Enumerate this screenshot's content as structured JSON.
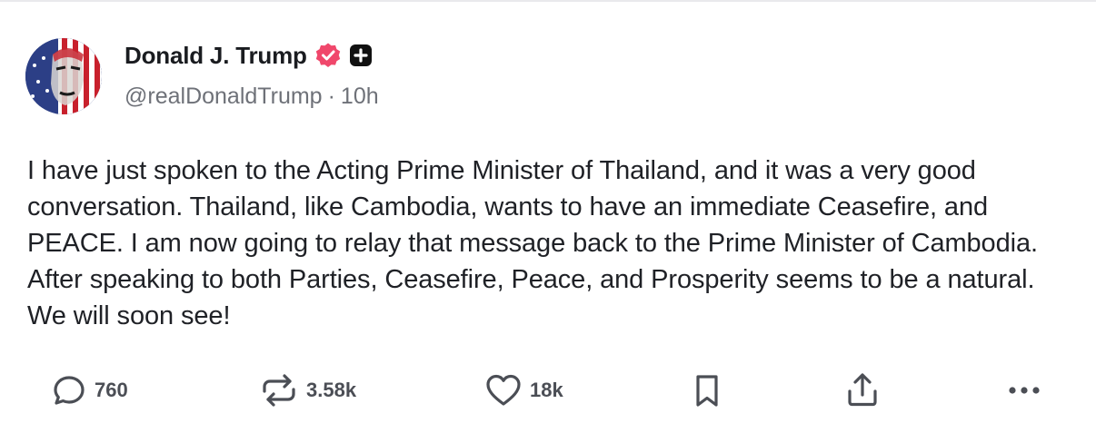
{
  "author": {
    "display_name": "Donald J. Trump",
    "handle": "@realDonaldTrump",
    "separator": "·",
    "time_ago": "10h",
    "verified_badge": "verified-check-icon",
    "badge_color": "#f0476b",
    "plus_badge": "plus-square-icon"
  },
  "post": {
    "text": "I have just spoken to the Acting Prime Minister of Thailand, and it was a very good conversation. Thailand, like Cambodia, wants to have an immediate Ceasefire, and PEACE. I am now going to relay that message back to the Prime Minister of Cambodia. After speaking to both Parties, Ceasefire, Peace, and Prosperity seems to be a natural. We will soon see!"
  },
  "actions": {
    "replies": {
      "icon": "reply-bubble-icon",
      "count": "760"
    },
    "retruths": {
      "icon": "repost-icon",
      "count": "3.58k"
    },
    "likes": {
      "icon": "heart-icon",
      "count": "18k"
    },
    "bookmark": {
      "icon": "bookmark-icon"
    },
    "share": {
      "icon": "share-upload-icon"
    },
    "more": {
      "icon": "more-dots-icon"
    }
  },
  "colors": {
    "text": "#1f2126",
    "muted": "#6e7178",
    "icon": "#4b4e55",
    "accent": "#f0476b"
  }
}
